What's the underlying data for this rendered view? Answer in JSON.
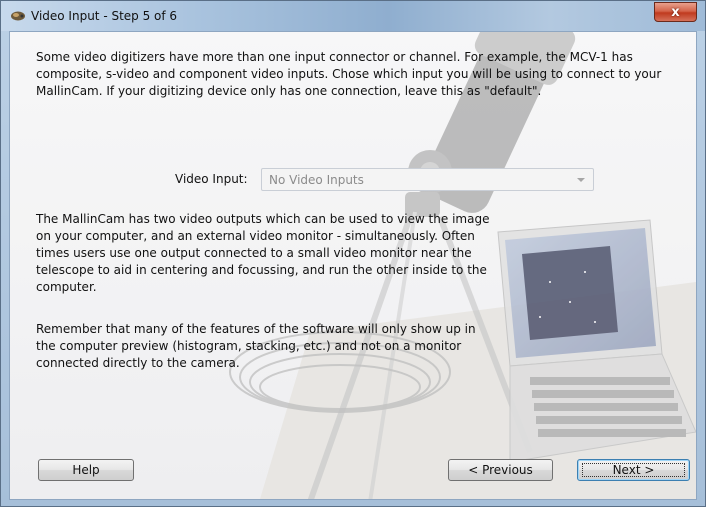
{
  "window": {
    "title": "Video Input - Step 5 of 6",
    "close_label": "x"
  },
  "content": {
    "intro": "Some video digitizers have more than one input connector or channel. For example, the MCV-1 has composite, s-video and component video inputs. Chose which input you will be using to connect to your MallinCam. If your digitizing device only has one connection, leave this as \"default\".",
    "video_input_label": "Video Input:",
    "video_input_value": "No Video Inputs",
    "paragraph_outputs": "The MallinCam has two video outputs which can be used to view the image on your computer, and an external video monitor - simultaneously. Often times users use one output connected to a small video monitor near the telescope to aid in centering and focussing, and run the other inside to the computer.",
    "paragraph_remember": "Remember that many of the features of the software will only show up in the computer preview (histogram, stacking, etc.) and not on a monitor connected directly to the camera."
  },
  "buttons": {
    "help": "Help",
    "previous": "< Previous",
    "next": "Next >"
  },
  "colors": {
    "titlebar": "#a9c3de",
    "close_button": "#c03a1f",
    "dialog_background": "#ffffff",
    "disabled_text": "#8b8b8b"
  },
  "icons": {
    "title_icon": "app-window-icon",
    "close": "close-icon",
    "dropdown": "chevron-down-icon"
  }
}
